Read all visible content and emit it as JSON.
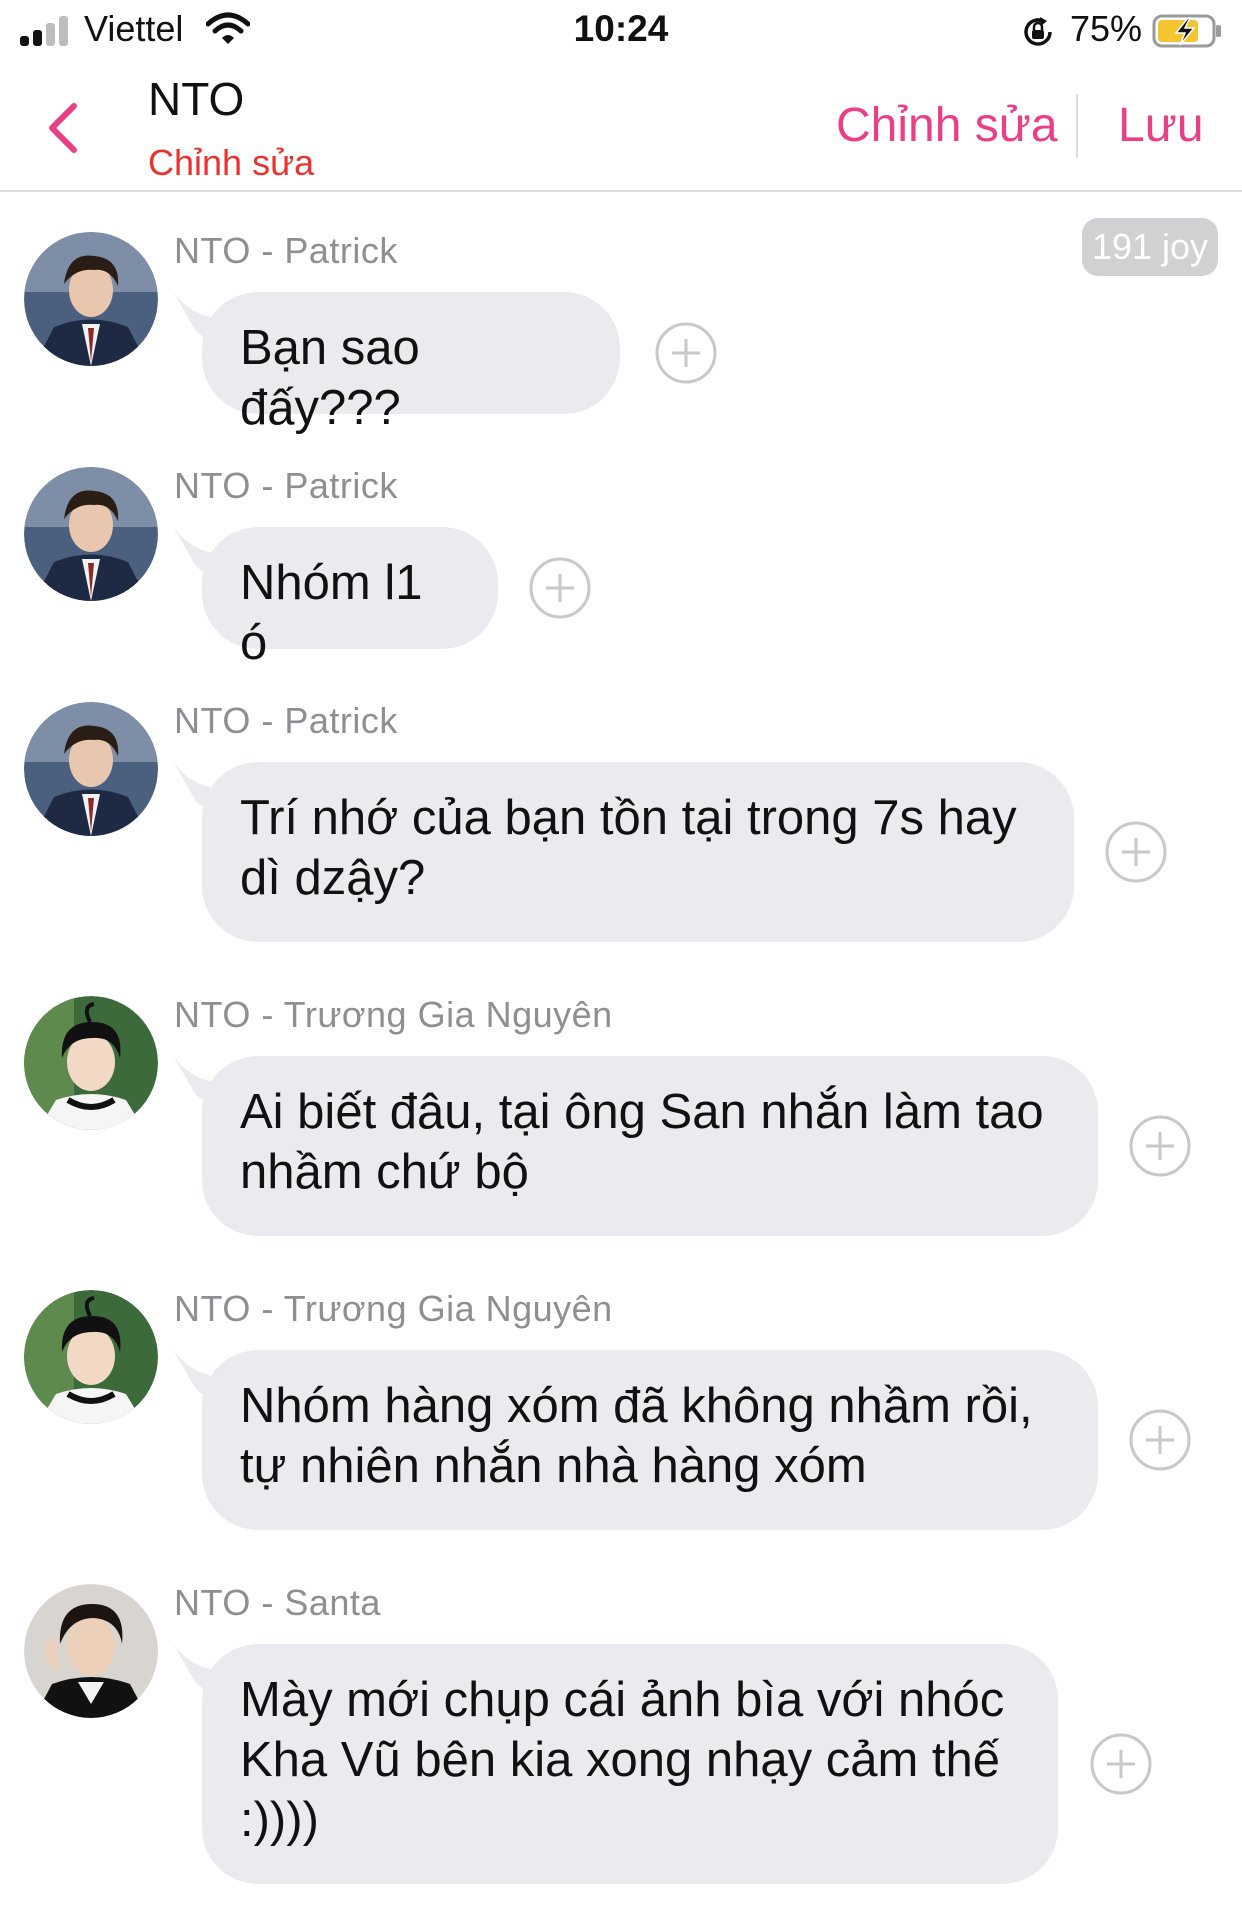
{
  "status_bar": {
    "carrier": "Viettel",
    "time": "10:24",
    "battery_percent": "75%",
    "icons": [
      "signal-icon",
      "wifi-icon",
      "orientation-lock-icon",
      "battery-charging-icon"
    ]
  },
  "header": {
    "title": "NTO",
    "subtitle": "Chỉnh sửa",
    "edit_label": "Chỉnh sửa",
    "save_label": "Lưu",
    "back_icon": "chevron-left-icon"
  },
  "joy_badge": "191 joy",
  "colors": {
    "accent": "#ea3f86",
    "subtitle_red": "#e8332f",
    "bubble_bg": "#e9ebee",
    "sender_gray": "#8e8e93",
    "badge_bg": "#cfd1d3"
  },
  "messages": [
    {
      "sender": "NTO - Patrick",
      "text": "Bạn sao đấy???",
      "avatar": "patrick"
    },
    {
      "sender": "NTO - Patrick",
      "text": "Nhóm l1 ó",
      "avatar": "patrick"
    },
    {
      "sender": "NTO - Patrick",
      "text": "Trí nhớ của bạn tồn tại trong 7s hay dì dzậy?",
      "avatar": "patrick"
    },
    {
      "sender": "NTO - Trương Gia Nguyên",
      "text": "Ai biết đâu, tại ông San nhắn làm tao nhầm chứ bộ",
      "avatar": "nguyen"
    },
    {
      "sender": "NTO - Trương Gia Nguyên",
      "text": "Nhóm hàng xóm đã không nhầm rồi, tự nhiên nhắn nhà hàng xóm",
      "avatar": "nguyen"
    },
    {
      "sender": "NTO - Santa",
      "text": "Mày mới chụp cái ảnh bìa với nhóc Kha Vũ bên kia xong nhạy cảm thế :))))",
      "avatar": "santa"
    }
  ]
}
